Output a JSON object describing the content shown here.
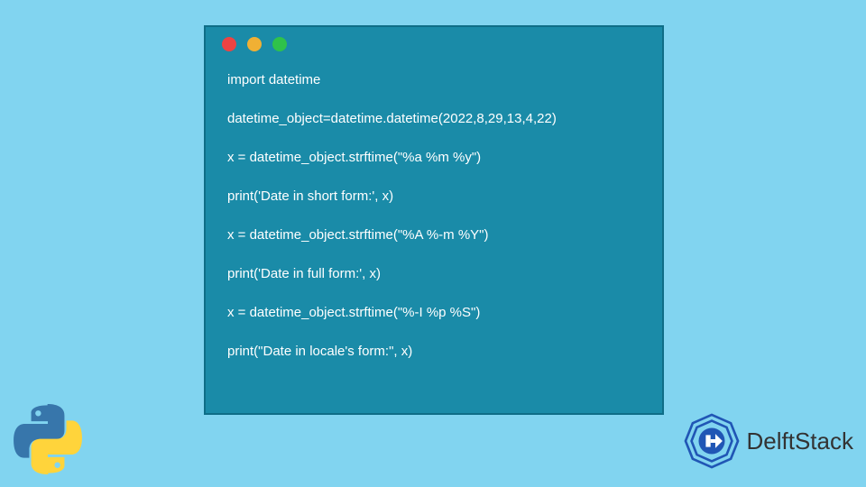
{
  "code": {
    "lines": [
      "import datetime",
      "datetime_object=datetime.datetime(2022,8,29,13,4,22)",
      "x = datetime_object.strftime(\"%a %m %y\")",
      "print('Date in short form:', x)",
      "x = datetime_object.strftime(\"%A %-m %Y\")",
      "print('Date in full form:', x)",
      "x = datetime_object.strftime(\"%-I %p %S\")",
      "print(\"Date in locale's form:\", x)"
    ]
  },
  "brand": {
    "name": "DelftStack"
  },
  "colors": {
    "background": "#81d4f0",
    "window": "#1a8ba8",
    "window_border": "#0e6d87",
    "dot_red": "#ed4343",
    "dot_yellow": "#f0b034",
    "dot_green": "#2fc24a",
    "code_text": "#ffffff"
  }
}
